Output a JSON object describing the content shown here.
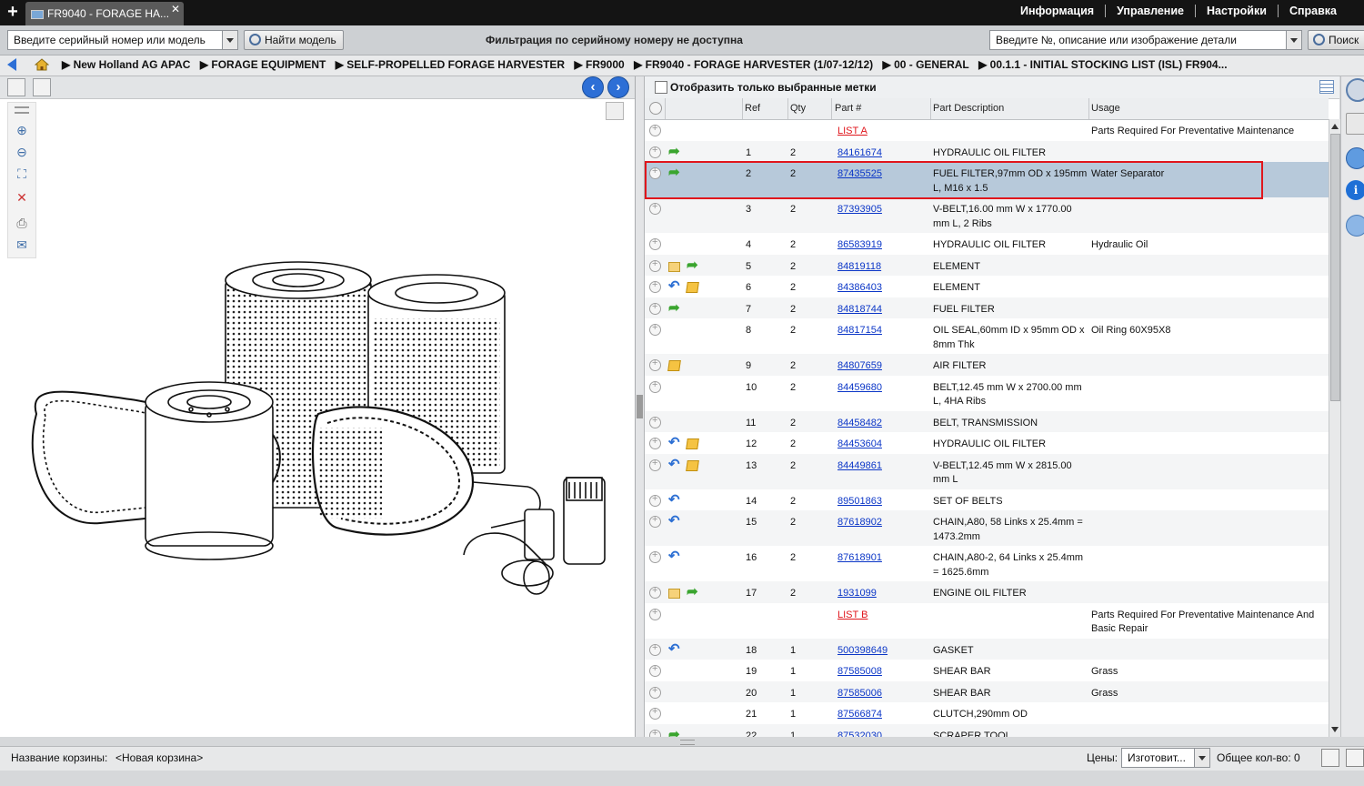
{
  "window": {
    "tab_title": "FR9040 - FORAGE HA...",
    "close_glyph": "✕",
    "new_tab_glyph": "+"
  },
  "top_menu": [
    "Информация",
    "Управление",
    "Настройки",
    "Справка"
  ],
  "toolbar": {
    "serial_placeholder": "Введите серийный номер или модель",
    "find_model_label": "Найти модель",
    "filter_message": "Фильтрация по серийному номеру не доступна",
    "part_search_placeholder": "Введите №, описание или изображение детали",
    "search_label": "Поиск"
  },
  "breadcrumb": [
    "▶ New Holland AG APAC",
    "▶ FORAGE EQUIPMENT",
    "▶ SELF-PROPELLED FORAGE HARVESTER",
    "▶ FR9000",
    "▶ FR9040 - FORAGE HARVESTER (1/07-12/12)",
    "▶ 00 - GENERAL",
    "▶ 00.1.1 - INITIAL STOCKING LIST (ISL) FR904..."
  ],
  "filter_bar": {
    "label": "Отобразить только выбранные метки"
  },
  "table": {
    "headers": {
      "ref": "Ref",
      "qty": "Qty",
      "part": "Part #",
      "desc": "Part Description",
      "usage": "Usage"
    },
    "rows": [
      {
        "ref": "",
        "qty": "",
        "part": "LIST A",
        "desc": "",
        "usage": "Parts Required For Preventative Maintenance",
        "icons": []
      },
      {
        "ref": "1",
        "qty": "2",
        "part": "84161674",
        "desc": "HYDRAULIC OIL FILTER",
        "usage": "",
        "icons": [
          "green-arrow"
        ]
      },
      {
        "ref": "2",
        "qty": "2",
        "part": "87435525",
        "desc": "FUEL FILTER,97mm OD x 195mm L, M16 x 1.5",
        "usage": "Water Separator",
        "icons": [
          "green-arrow"
        ]
      },
      {
        "ref": "3",
        "qty": "2",
        "part": "87393905",
        "desc": "V-BELT,16.00 mm W x 1770.00 mm L, 2 Ribs",
        "usage": "",
        "icons": []
      },
      {
        "ref": "4",
        "qty": "2",
        "part": "86583919",
        "desc": "HYDRAULIC OIL FILTER",
        "usage": "Hydraulic Oil",
        "icons": []
      },
      {
        "ref": "5",
        "qty": "2",
        "part": "84819118",
        "desc": "ELEMENT",
        "usage": "",
        "icons": [
          "note",
          "green-arrow"
        ]
      },
      {
        "ref": "6",
        "qty": "2",
        "part": "84386403",
        "desc": "ELEMENT",
        "usage": "",
        "icons": [
          "blue-arrow",
          "box"
        ]
      },
      {
        "ref": "7",
        "qty": "2",
        "part": "84818744",
        "desc": "FUEL FILTER",
        "usage": "",
        "icons": [
          "green-arrow"
        ]
      },
      {
        "ref": "8",
        "qty": "2",
        "part": "84817154",
        "desc": "OIL SEAL,60mm ID x 95mm OD x 8mm Thk",
        "usage": "Oil Ring 60X95X8",
        "icons": []
      },
      {
        "ref": "9",
        "qty": "2",
        "part": "84807659",
        "desc": "AIR FILTER",
        "usage": "",
        "icons": [
          "box"
        ]
      },
      {
        "ref": "10",
        "qty": "2",
        "part": "84459680",
        "desc": "BELT,12.45 mm W x 2700.00 mm L, 4HA Ribs",
        "usage": "",
        "icons": []
      },
      {
        "ref": "11",
        "qty": "2",
        "part": "84458482",
        "desc": "BELT, TRANSMISSION",
        "usage": "",
        "icons": []
      },
      {
        "ref": "12",
        "qty": "2",
        "part": "84453604",
        "desc": "HYDRAULIC OIL FILTER",
        "usage": "",
        "icons": [
          "blue-arrow",
          "box"
        ]
      },
      {
        "ref": "13",
        "qty": "2",
        "part": "84449861",
        "desc": "V-BELT,12.45 mm W x 2815.00 mm L",
        "usage": "",
        "icons": [
          "blue-arrow",
          "box"
        ]
      },
      {
        "ref": "14",
        "qty": "2",
        "part": "89501863",
        "desc": "SET OF BELTS",
        "usage": "",
        "icons": [
          "blue-arrow"
        ]
      },
      {
        "ref": "15",
        "qty": "2",
        "part": "87618902",
        "desc": "CHAIN,A80, 58 Links x 25.4mm = 1473.2mm",
        "usage": "",
        "icons": [
          "blue-arrow"
        ]
      },
      {
        "ref": "16",
        "qty": "2",
        "part": "87618901",
        "desc": "CHAIN,A80-2, 64 Links x 25.4mm = 1625.6mm",
        "usage": "",
        "icons": [
          "blue-arrow"
        ]
      },
      {
        "ref": "17",
        "qty": "2",
        "part": "1931099",
        "desc": "ENGINE OIL FILTER",
        "usage": "",
        "icons": [
          "note",
          "green-arrow"
        ]
      },
      {
        "ref": "",
        "qty": "",
        "part": "LIST B",
        "desc": "",
        "usage": "Parts Required For Preventative Maintenance And Basic Repair",
        "icons": []
      },
      {
        "ref": "18",
        "qty": "1",
        "part": "500398649",
        "desc": "GASKET",
        "usage": "",
        "icons": [
          "blue-arrow"
        ]
      },
      {
        "ref": "19",
        "qty": "1",
        "part": "87585008",
        "desc": "SHEAR BAR",
        "usage": "Grass",
        "icons": []
      },
      {
        "ref": "20",
        "qty": "1",
        "part": "87585006",
        "desc": "SHEAR BAR",
        "usage": "Grass",
        "icons": []
      },
      {
        "ref": "21",
        "qty": "1",
        "part": "87566874",
        "desc": "CLUTCH,290mm OD",
        "usage": "",
        "icons": []
      },
      {
        "ref": "22",
        "qty": "1",
        "part": "87532030",
        "desc": "SCRAPER TOOL",
        "usage": "",
        "icons": [
          "green-arrow"
        ]
      }
    ],
    "selected_index": 2
  },
  "bottom": {
    "cart_label": "Название корзины:",
    "cart_name": "<Новая корзина>",
    "prices_label": "Цены:",
    "prices_value": "Изготовит...",
    "total_label": "Общее кол-во: 0"
  },
  "colors": {
    "accent": "#2d6fd6",
    "link": "#0b36c7",
    "list_link": "#e0161c",
    "selection": "#b7c9da",
    "highlight_box": "#e0161c"
  }
}
